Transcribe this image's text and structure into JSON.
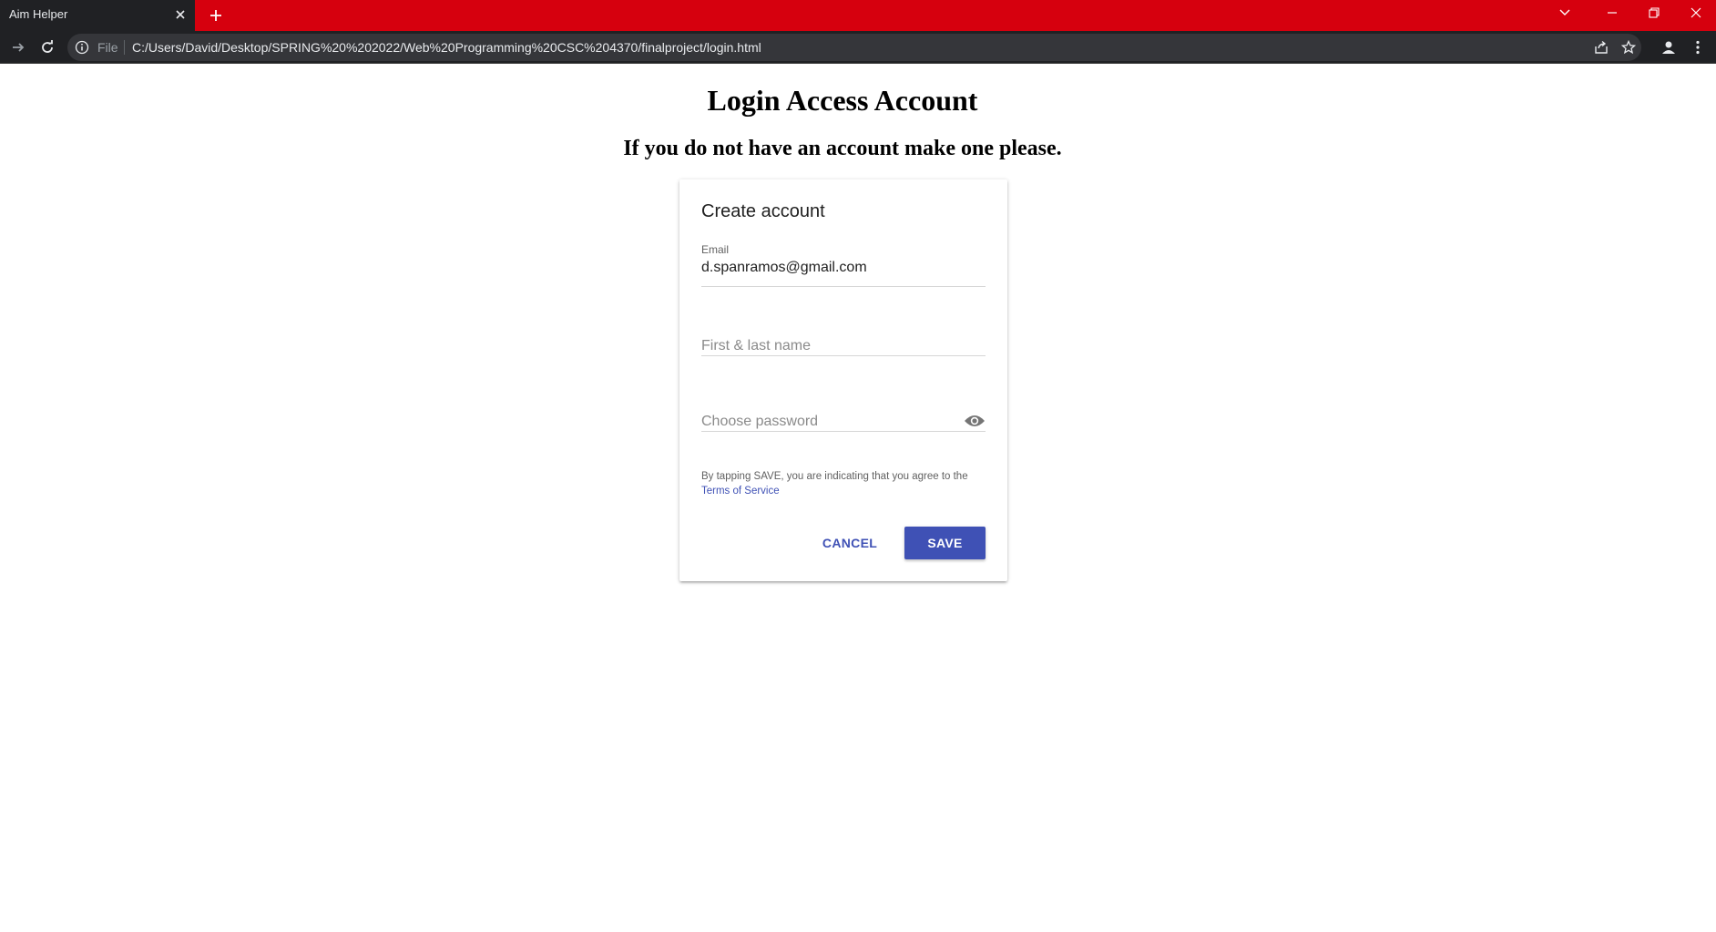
{
  "browser": {
    "tab_title": "Aim Helper",
    "omnibox": {
      "file_chip": "File",
      "url": "C:/Users/David/Desktop/SPRING%20%202022/Web%20Programming%20CSC%204370/finalproject/login.html"
    },
    "colors": {
      "tabstrip": "#d6000e",
      "toolbar": "#202124"
    }
  },
  "page": {
    "heading": "Login Access Account",
    "subheading": "If you do not have an account make one please."
  },
  "form": {
    "title": "Create account",
    "email": {
      "label": "Email",
      "value": "d.spanramos@gmail.com"
    },
    "name": {
      "placeholder": "First & last name"
    },
    "password": {
      "placeholder": "Choose password"
    },
    "terms_text": "By tapping SAVE, you are indicating that you agree to the",
    "terms_link": "Terms of Service",
    "cancel_label": "CANCEL",
    "save_label": "SAVE",
    "accent_color": "#3f51b5"
  }
}
